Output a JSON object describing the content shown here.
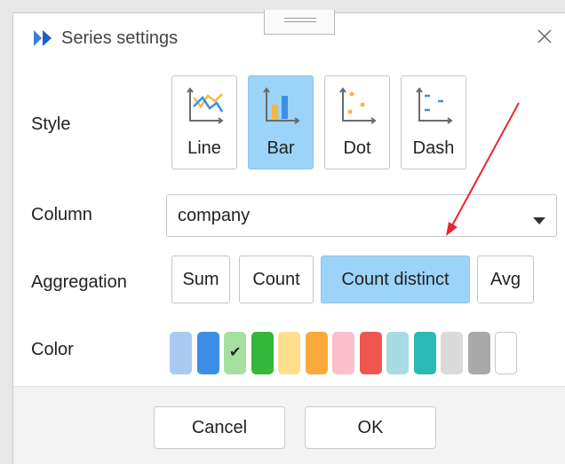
{
  "dialog": {
    "title": "Series settings",
    "close_icon": "close-icon",
    "app_icon": "app-logo-icon"
  },
  "style": {
    "label": "Style",
    "options": [
      {
        "label": "Line",
        "icon": "line-chart-icon",
        "selected": false
      },
      {
        "label": "Bar",
        "icon": "bar-chart-icon",
        "selected": true
      },
      {
        "label": "Dot",
        "icon": "dot-chart-icon",
        "selected": false
      },
      {
        "label": "Dash",
        "icon": "dash-chart-icon",
        "selected": false
      }
    ]
  },
  "column": {
    "label": "Column",
    "value": "company",
    "icon": "chevron-down-icon"
  },
  "aggregation": {
    "label": "Aggregation",
    "options": [
      {
        "label": "Sum",
        "selected": false
      },
      {
        "label": "Count",
        "selected": false
      },
      {
        "label": "Count distinct",
        "selected": true
      },
      {
        "label": "Avg",
        "selected": false
      }
    ]
  },
  "color": {
    "label": "Color",
    "swatches": [
      {
        "color": "#a9cbf2",
        "selected": false
      },
      {
        "color": "#3d8fe6",
        "selected": false
      },
      {
        "color": "#a7dfa0",
        "selected": true
      },
      {
        "color": "#33b83a",
        "selected": false
      },
      {
        "color": "#fedf8e",
        "selected": false
      },
      {
        "color": "#fba93a",
        "selected": false
      },
      {
        "color": "#fbbfce",
        "selected": false
      },
      {
        "color": "#ef564f",
        "selected": false
      },
      {
        "color": "#a9dbe3",
        "selected": false
      },
      {
        "color": "#2ab9b4",
        "selected": false
      },
      {
        "color": "#dadada",
        "selected": false
      },
      {
        "color": "#a9a9a9",
        "selected": false
      },
      {
        "color": "#ffffff",
        "selected": false
      }
    ]
  },
  "footer": {
    "cancel_label": "Cancel",
    "ok_label": "OK"
  },
  "colors": {
    "accent": "#9cd3f8",
    "arrow": "#e8282c"
  }
}
